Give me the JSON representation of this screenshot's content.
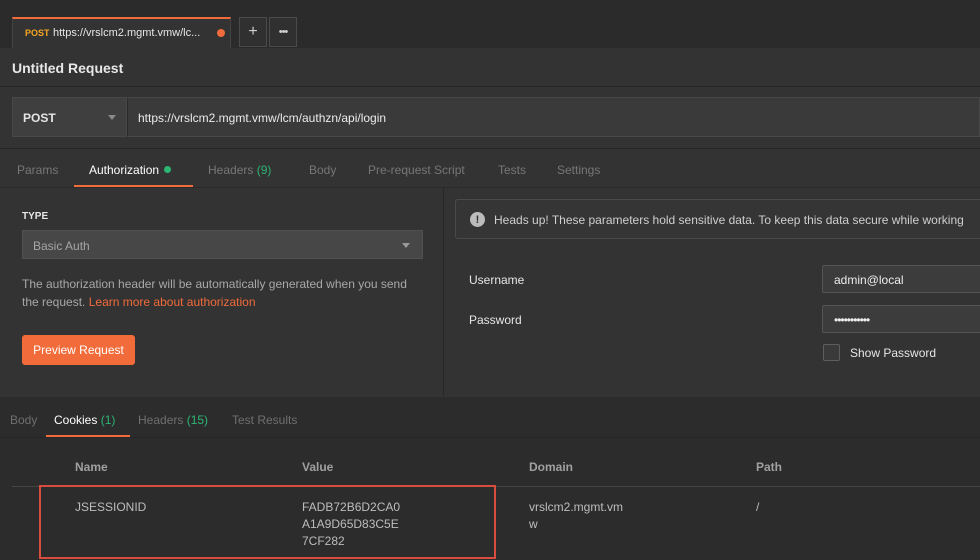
{
  "tab_strip": {
    "active_tab": {
      "method": "POST",
      "title": "https://vrslcm2.mgmt.vmw/lc..."
    },
    "new_tab_label": "+",
    "more_label": "•••"
  },
  "request": {
    "title": "Untitled Request",
    "method": "POST",
    "url": "https://vrslcm2.mgmt.vmw/lcm/authzn/api/login"
  },
  "request_tabs": [
    {
      "label": "Params",
      "count": ""
    },
    {
      "label": "Authorization",
      "count": ""
    },
    {
      "label": "Headers",
      "count": "(9)"
    },
    {
      "label": "Body",
      "count": ""
    },
    {
      "label": "Pre-request Script",
      "count": ""
    },
    {
      "label": "Tests",
      "count": ""
    },
    {
      "label": "Settings",
      "count": ""
    }
  ],
  "auth": {
    "type_label": "TYPE",
    "type_value": "Basic Auth",
    "description": "The authorization header will be automatically generated when you send the request.",
    "learn_more": "Learn more about authorization",
    "preview_button": "Preview Request",
    "warning": "Heads up! These parameters hold sensitive data. To keep this data secure while working",
    "username_label": "Username",
    "username_value": "admin@local",
    "password_label": "Password",
    "password_value": "•••••••••••",
    "show_password_label": "Show Password"
  },
  "response_tabs": [
    {
      "label": "Body",
      "count": ""
    },
    {
      "label": "Cookies",
      "count": "(1)"
    },
    {
      "label": "Headers",
      "count": "(15)"
    },
    {
      "label": "Test Results",
      "count": ""
    }
  ],
  "cookies_table": {
    "columns": [
      "Name",
      "Value",
      "Domain",
      "Path"
    ],
    "rows": [
      {
        "name": "JSESSIONID",
        "value": "FADB72B6D2CA0A1A9D65D83C5E7CF282",
        "domain": "vrslcm2.mgmt.vmw",
        "path": "/"
      }
    ]
  },
  "colors": {
    "accent": "#f26b3a",
    "count_green": "#2bb673",
    "background": "#333333",
    "highlight_box": "#d94d3f"
  }
}
